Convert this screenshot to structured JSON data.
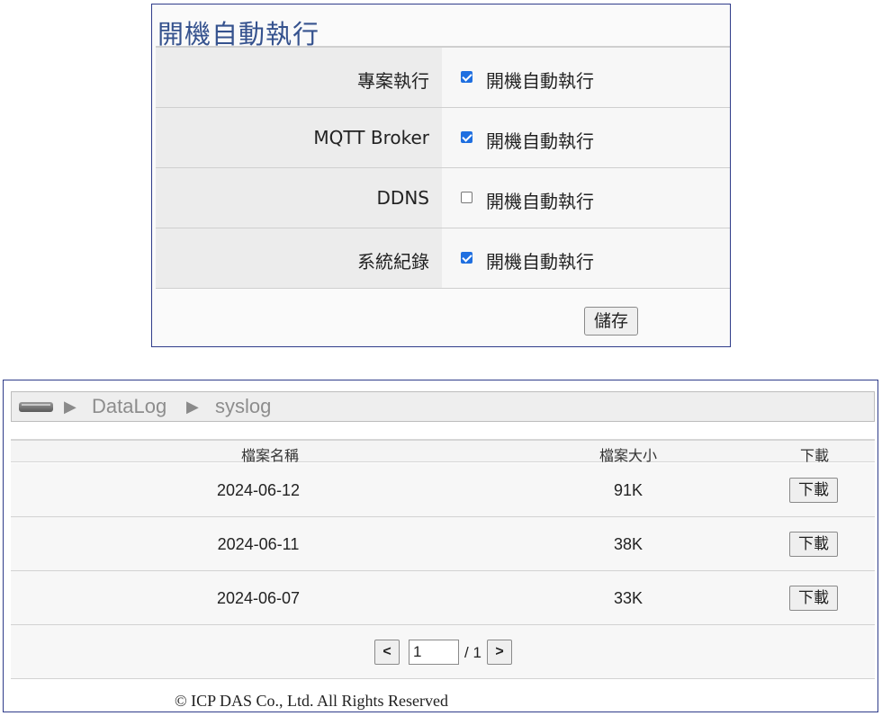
{
  "autostart": {
    "title": "開機自動執行",
    "rows": [
      {
        "label": "專案執行",
        "checkbox_label": "開機自動執行",
        "checked": true
      },
      {
        "label": "MQTT Broker",
        "checkbox_label": "開機自動執行",
        "checked": true
      },
      {
        "label": "DDNS",
        "checkbox_label": "開機自動執行",
        "checked": false
      },
      {
        "label": "系統紀錄",
        "checkbox_label": "開機自動執行",
        "checked": true
      }
    ],
    "save_label": "儲存"
  },
  "browser": {
    "drive_icon": "drive-icon",
    "breadcrumb": [
      "DataLog",
      "syslog"
    ],
    "breadcrumb_separator": "▶",
    "columns": {
      "name": "檔案名稱",
      "size": "檔案大小",
      "download": "下載"
    },
    "files": [
      {
        "name": "2024-06-12",
        "size": "91K",
        "download_label": "下載"
      },
      {
        "name": "2024-06-11",
        "size": "38K",
        "download_label": "下載"
      },
      {
        "name": "2024-06-07",
        "size": "33K",
        "download_label": "下載"
      }
    ],
    "pager": {
      "prev": "<",
      "next": ">",
      "page": "1",
      "total": "/ 1"
    },
    "footer": "© ICP DAS Co., Ltd. All Rights Reserved"
  }
}
